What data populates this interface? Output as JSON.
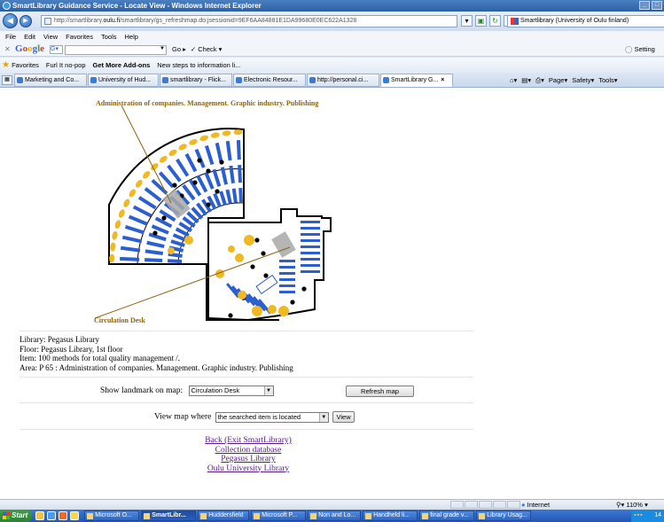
{
  "window": {
    "title": "SmartLibrary Guidance Service - Locate View - Windows Internet Explorer",
    "controls": [
      "_",
      "□"
    ]
  },
  "address_bar": {
    "url_prefix": "http://smartlibrary.",
    "url_domain": "oulu.fi",
    "url_path": "/smartlibrary/gs_refreshmap.do;jsessionid=9EF6AA84881E1DA99680E0EC622A1328",
    "site_label": "Smartlibrary (University of Oulu finland)"
  },
  "menu": [
    "File",
    "Edit",
    "View",
    "Favorites",
    "Tools",
    "Help"
  ],
  "google_toolbar": {
    "logo": [
      "G",
      "o",
      "o",
      "g",
      "l",
      "e"
    ],
    "go_label": "Go",
    "check_label": "Check",
    "settings_label": "Setting"
  },
  "favorites_bar": {
    "favorites_label": "Favorites",
    "items": [
      "Furl It no-pop",
      "Get More Add-ons",
      "New steps to information li..."
    ]
  },
  "tabs": [
    {
      "label": "Marketing and Co...",
      "active": false
    },
    {
      "label": "University of Hud...",
      "active": false
    },
    {
      "label": "smartlibrary - Flick...",
      "active": false
    },
    {
      "label": "Electronic Resour...",
      "active": false
    },
    {
      "label": "http://personal.ci...",
      "active": false
    },
    {
      "label": "SmartLibrary G...",
      "active": true
    }
  ],
  "command_bar": [
    "Page",
    "Safety",
    "Tools"
  ],
  "map": {
    "top_label": "Administration of companies. Management. Graphic industry. Publishing",
    "bottom_label": "Circulation Desk",
    "colors": {
      "shelf": "#2b5fcf",
      "landmark": "#f0b823",
      "wall": "#000000",
      "highlight": "#a8a8a8",
      "label": "#8a6410"
    }
  },
  "info": {
    "library": "Library: Pegasus Library",
    "floor": "Floor: Pegasus Library, 1st floor",
    "item": "Item: 100 methods for total quality management /.",
    "area": "Area: P 65 : Administration of companies. Management. Graphic industry. Publishing"
  },
  "landmark_form": {
    "label": "Show landmark on map:",
    "selected": "Circulation Desk",
    "refresh_button": "Refresh map"
  },
  "view_form": {
    "label": "View map where",
    "selected": "the searched item is located",
    "view_button": "View"
  },
  "links": [
    "Back (Exit SmartLibrary)",
    "Collection database",
    "Pegasus Library",
    "Oulu University Library"
  ],
  "status_bar": {
    "zone": "Internet",
    "zoom": "110%"
  },
  "taskbar": {
    "start_label": "Start",
    "tasks": [
      {
        "label": "Microsoft O...",
        "active": false
      },
      {
        "label": "SmartLibr...",
        "active": true
      },
      {
        "label": "Huddersfield",
        "active": false
      },
      {
        "label": "Microsoft P...",
        "active": false
      },
      {
        "label": "Non and Lo...",
        "active": false
      },
      {
        "label": "Handheld li...",
        "active": false
      },
      {
        "label": "final grade v...",
        "active": false
      },
      {
        "label": "Library Usag...",
        "active": false
      }
    ],
    "clock": "14"
  }
}
